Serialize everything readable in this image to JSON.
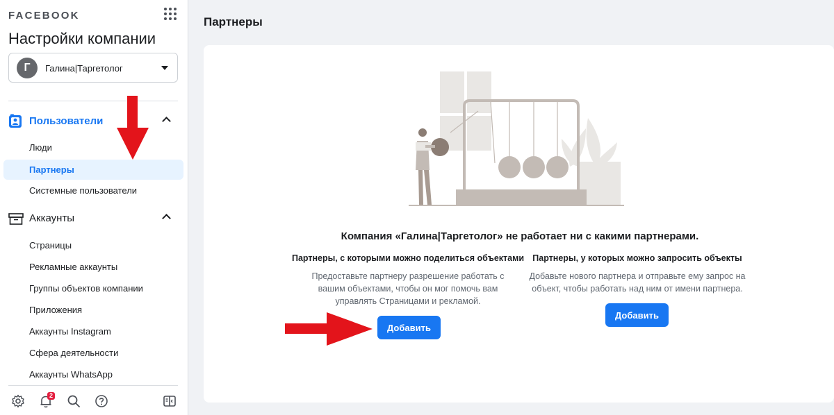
{
  "sidebar": {
    "brand": "FACEBOOK",
    "title": "Настройки компании",
    "account": {
      "avatar_letter": "Г",
      "name": "Галина|Таргетолог"
    },
    "sections": [
      {
        "label": "Пользователи",
        "icon": "users-icon",
        "items": [
          "Люди",
          "Партнеры",
          "Системные пользователи"
        ],
        "active_item": "Партнеры"
      },
      {
        "label": "Аккаунты",
        "icon": "accounts-box-icon",
        "items": [
          "Страницы",
          "Рекламные аккаунты",
          "Группы объектов компании",
          "Приложения",
          "Аккаунты Instagram",
          "Сфера деятельности",
          "Аккаунты WhatsApp"
        ]
      }
    ],
    "bottom_icons": [
      "gear-icon",
      "bell-icon",
      "search-icon",
      "help-icon",
      "panel-toggle-icon"
    ],
    "notifications_badge": "2"
  },
  "main": {
    "page_title": "Партнеры",
    "empty_title": "Компания «Галина|Таргетолог» не работает ни с какими партнерами.",
    "left_col": {
      "title": "Партнеры, с которыми можно поделиться объектами",
      "desc": "Предоставьте партнеру разрешение работать с вашим объектами, чтобы он мог помочь вам управлять Страницами и рекламой.",
      "button": "Добавить"
    },
    "right_col": {
      "title": "Партнеры, у которых можно запросить объекты",
      "desc": "Добавьте нового партнера и отправьте ему запрос на объект, чтобы работать над ним от имени партнера.",
      "button": "Добавить"
    }
  },
  "colors": {
    "accent": "#1877f2",
    "annotation_arrow": "#e3141b",
    "active_bg": "#e7f3ff"
  }
}
